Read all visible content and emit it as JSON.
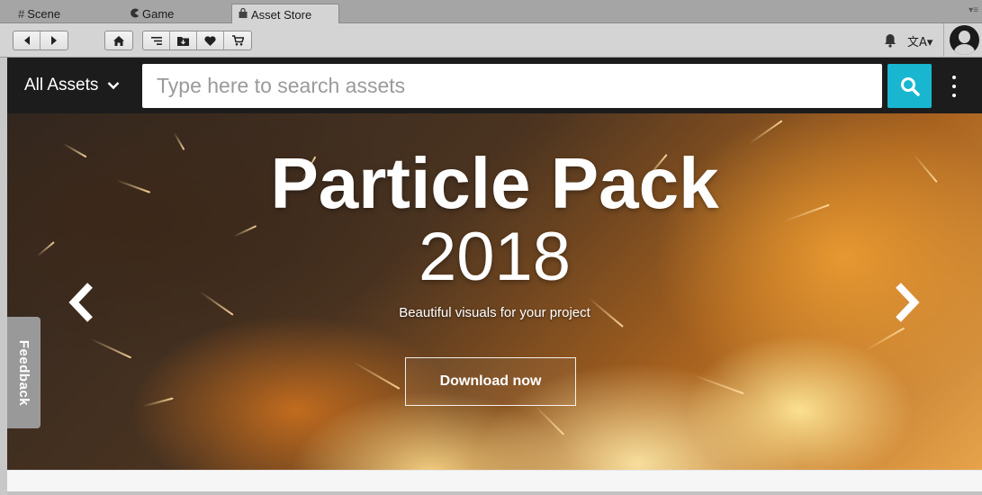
{
  "tabs": [
    {
      "label": "Scene",
      "icon": "grid-icon"
    },
    {
      "label": "Game",
      "icon": "pacman-icon"
    },
    {
      "label": "Asset Store",
      "icon": "bag-icon",
      "active": true
    }
  ],
  "toolbar": {
    "nav_icons": [
      "back-arrow-icon",
      "forward-arrow-icon"
    ],
    "home_icon": "home-icon",
    "store_icons": [
      "menu-lines-icon",
      "download-folder-icon",
      "heart-icon",
      "cart-icon"
    ],
    "notifications_icon": "bell-icon",
    "language_icon": "translate-icon",
    "language_label": "文A▾",
    "account_icon": "avatar-icon"
  },
  "search": {
    "category_label": "All Assets",
    "placeholder": "Type here to search assets",
    "value": "",
    "accent_color": "#19b6d0"
  },
  "banner": {
    "title": "Particle Pack",
    "year": "2018",
    "subtitle": "Beautiful visuals for your project",
    "cta_label": "Download now"
  },
  "feedback": {
    "label": "Feedback"
  }
}
